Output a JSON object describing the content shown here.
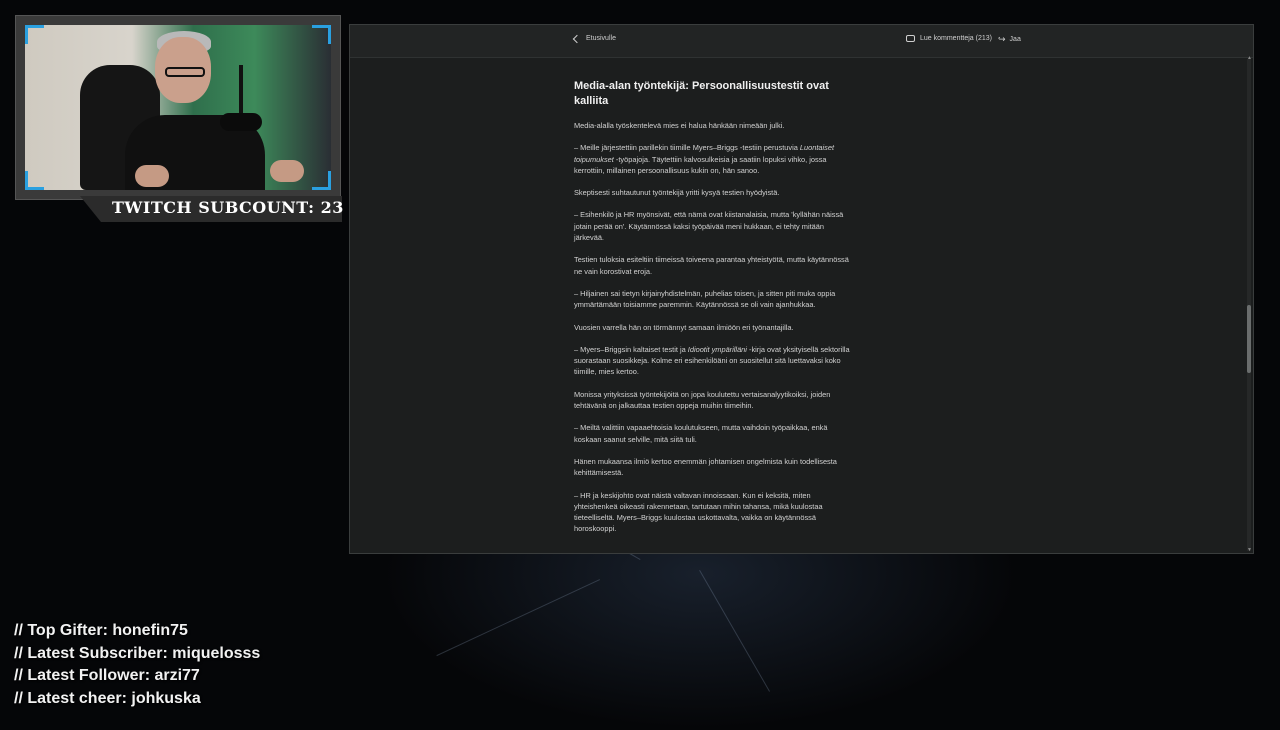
{
  "overlay": {
    "subcount": "TWITCH SUBCOUNT: 23",
    "stats": [
      "// Top Gifter: honefin75",
      "// Latest Subscriber: miquelosss",
      "// Latest Follower: arzi77",
      "// Latest cheer: johkuska"
    ]
  },
  "browser": {
    "back_label": "Etusivulle",
    "comments_label": "Lue kommentteja (213)",
    "share_label": "Jaa"
  },
  "article": {
    "heading": "Media-alan työntekijä: Persoonallisuustestit ovat kalliita",
    "p1": "Media-alalla työskentelevä mies ei halua hänkään nimeään julki.",
    "p2_a": "– Meille järjestettiin parillekin tiimille Myers–Briggs -testiin perustuvia ",
    "p2_em": "Luontaiset toipumukset",
    "p2_b": " -työpajoja. Täytettiin kalvosulkeisia ja saatiin lopuksi vihko, jossa kerrottiin, millainen persoonallisuus kukin on, hän sanoo.",
    "p3": "Skeptisesti suhtautunut työntekijä yritti kysyä testien hyödyistä.",
    "p4": "– Esihenkilö ja HR myönsivät, että nämä ovat kiistanalaisia, mutta 'kyllähän näissä jotain perää on'. Käytännössä kaksi työpäivää meni hukkaan, ei tehty mitään järkevää.",
    "p5": "Testien tuloksia esiteltiin tiimeissä toiveena parantaa yhteistyötä, mutta käytännössä ne vain korostivat eroja.",
    "p6": "– Hiljainen sai tietyn kirjainyhdistelmän, puhelias toisen, ja sitten piti muka oppia ymmärtämään toisiamme paremmin. Käytännössä se oli vain ajanhukkaa.",
    "p7": "Vuosien varrella hän on törmännyt samaan ilmiöön eri työnantajilla.",
    "p8_a": "– Myers–Briggsin kaltaiset testit ja ",
    "p8_em": "Idiootit ympärilläni",
    "p8_b": " -kirja ovat yksityisellä sektorilla suorastaan suosikkeja. Kolme eri esihenkilöäni on suositellut sitä luettavaksi koko tiimille, mies kertoo.",
    "p9": "Monissa yrityksissä työntekijöitä on jopa koulutettu vertaisanalyytikoiksi, joiden tehtävänä on jalkauttaa testien oppeja muihin tiimeihin.",
    "p10": "– Meiltä valittiin vapaaehtoisia koulutukseen, mutta vaihdoin työpaikkaa, enkä koskaan saanut selville, mitä siitä tuli.",
    "p11": "Hänen mukaansa ilmiö kertoo enemmän johtamisen ongelmista kuin todellisesta kehittämisestä.",
    "p12": "– HR ja keskijohto ovat näistä valtavan innoissaan. Kun ei keksitä, miten yhteishenkeä oikeasti rakennetaan, tartutaan mihin tahansa, mikä kuulostaa tieteelliseltä. Myers–Briggs kuulostaa uskottavalta, vaikka on käytännössä horoskooppi."
  },
  "colors": {
    "accent": "#2aa0e0",
    "window_bg": "#1c1e1e",
    "page_bg": "#050608"
  }
}
